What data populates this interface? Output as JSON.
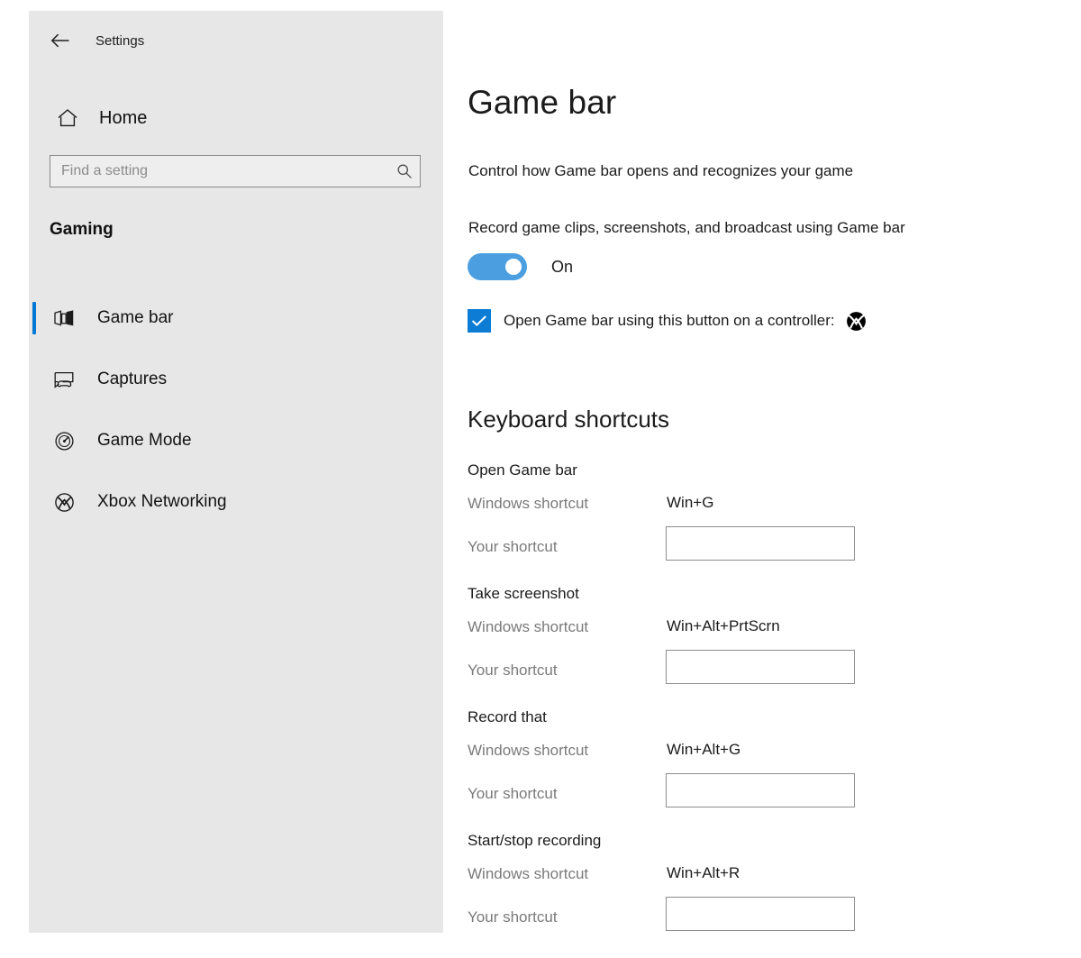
{
  "window": {
    "back_label": "back-arrow",
    "title": "Settings"
  },
  "sidebar": {
    "home_label": "Home",
    "home_icon": "home-icon",
    "search": {
      "placeholder": "Find a setting",
      "value": "",
      "icon": "search-icon"
    },
    "category": "Gaming",
    "items": [
      {
        "label": "Game bar",
        "icon": "game-bar-icon",
        "selected": true
      },
      {
        "label": "Captures",
        "icon": "captures-icon",
        "selected": false
      },
      {
        "label": "Game Mode",
        "icon": "game-mode-icon",
        "selected": false
      },
      {
        "label": "Xbox Networking",
        "icon": "xbox-icon",
        "selected": false
      }
    ]
  },
  "main": {
    "title": "Game bar",
    "subtitle": "Control how Game bar opens and recognizes your game",
    "record_setting_label": "Record game clips, screenshots, and broadcast using Game bar",
    "toggle_state": "On",
    "toggle_on": true,
    "controller_checkbox": {
      "label": "Open Game bar using this button on a controller:",
      "checked": true,
      "glyph": "xbox-icon"
    },
    "shortcuts_heading": "Keyboard shortcuts",
    "shortcuts": [
      {
        "name": "Open Game bar",
        "windows_label": "Windows shortcut",
        "windows_value": "Win+G",
        "your_label": "Your shortcut",
        "your_value": ""
      },
      {
        "name": "Take screenshot",
        "windows_label": "Windows shortcut",
        "windows_value": "Win+Alt+PrtScrn",
        "your_label": "Your shortcut",
        "your_value": ""
      },
      {
        "name": "Record that",
        "windows_label": "Windows shortcut",
        "windows_value": "Win+Alt+G",
        "your_label": "Your shortcut",
        "your_value": ""
      },
      {
        "name": "Start/stop recording",
        "windows_label": "Windows shortcut",
        "windows_value": "Win+Alt+R",
        "your_label": "Your shortcut",
        "your_value": ""
      }
    ]
  },
  "colors": {
    "accent": "#0078d4",
    "toggle_on": "#4b9fe1",
    "checkbox": "#0c7cd5",
    "sidebar_bg": "#e7e7e7",
    "main_bg": "#ffffff",
    "muted_text": "#7a7a7a"
  }
}
